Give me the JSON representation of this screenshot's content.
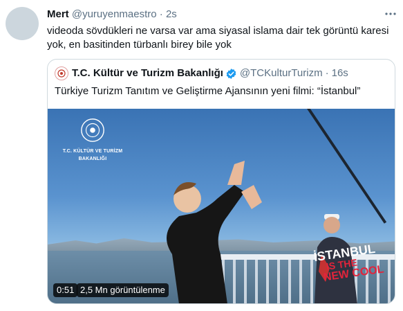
{
  "tweet": {
    "author_name": "Mert",
    "author_handle": "@yuruyenmaestro",
    "separator": "·",
    "time": "2s",
    "text": "videoda sövdükleri ne varsa var ama siyasal islama dair tek görüntü karesi yok, en basitinden türbanlı birey bile yok",
    "more_icon": "more-horizontal-icon"
  },
  "quoted_tweet": {
    "author_name": "T.C. Kültür ve Turizm Bakanlığı",
    "author_handle": "@TCKulturTurizm",
    "separator": "·",
    "time": "16s",
    "verified_icon": "verified-badge-icon",
    "text": "Türkiye Turizm Tanıtım ve Geliştirme Ajansının yeni filmi: “İstanbul”",
    "media": {
      "logo_line1": "T.C. KÜLTÜR VE TURİZM",
      "logo_line2": "BAKANLIĞI",
      "overlay_line1": "İSTANBUL",
      "overlay_line2": "IS THE",
      "overlay_line3": "NEW COOL",
      "duration": "0:51",
      "views": "2,5 Mn görüntülenme"
    }
  },
  "colors": {
    "text": "#0f1419",
    "secondary": "#5b7083",
    "verified": "#1d9bf0",
    "border": "#cfd9de",
    "overlay_red": "#e2243b"
  }
}
